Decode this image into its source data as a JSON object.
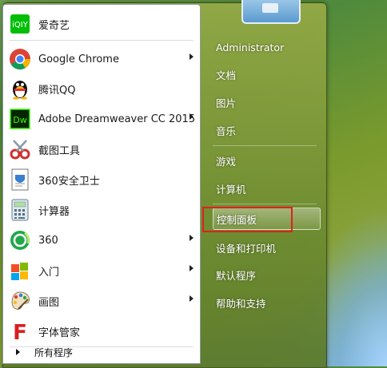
{
  "programs": [
    {
      "label": "爱奇艺",
      "icon": "iqiyi-icon",
      "has_submenu": false
    },
    {
      "label": "Google Chrome",
      "icon": "chrome-icon",
      "has_submenu": true
    },
    {
      "label": "腾讯QQ",
      "icon": "qq-penguin-icon",
      "has_submenu": false
    },
    {
      "label": "Adobe Dreamweaver CC 2015",
      "icon": "dreamweaver-icon",
      "has_submenu": true
    },
    {
      "label": "截图工具",
      "icon": "scissors-icon",
      "has_submenu": false
    },
    {
      "label": "360安全卫士",
      "icon": "360-safe-icon",
      "has_submenu": false
    },
    {
      "label": "计算器",
      "icon": "calculator-icon",
      "has_submenu": false
    },
    {
      "label": "360",
      "icon": "360-icon",
      "has_submenu": true
    },
    {
      "label": "入门",
      "icon": "getting-started-icon",
      "has_submenu": true
    },
    {
      "label": "画图",
      "icon": "paint-palette-icon",
      "has_submenu": true
    },
    {
      "label": "字体管家",
      "icon": "font-manager-icon",
      "has_submenu": false
    }
  ],
  "all_programs_label": "所有程序",
  "right_items": [
    {
      "label": "Administrator"
    },
    {
      "label": "文档"
    },
    {
      "label": "图片"
    },
    {
      "label": "音乐"
    },
    {
      "label": "游戏"
    },
    {
      "label": "计算机"
    },
    {
      "label": "控制面板"
    },
    {
      "label": "设备和打印机"
    },
    {
      "label": "默认程序"
    },
    {
      "label": "帮助和支持"
    }
  ],
  "highlight_color": "#e02020"
}
